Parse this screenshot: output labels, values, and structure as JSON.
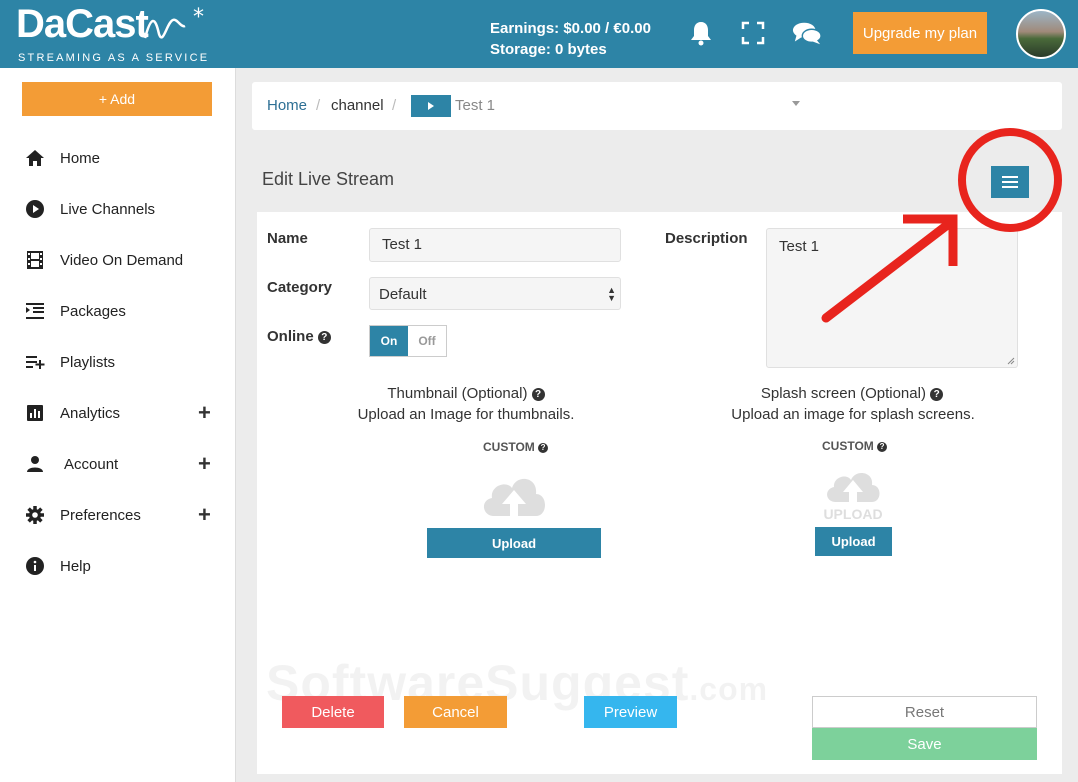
{
  "header": {
    "logo_text": "DaCast",
    "logo_tagline": "STREAMING AS A SERVICE",
    "earnings": "Earnings: $0.00 / €0.00",
    "storage": "Storage: 0 bytes",
    "upgrade_label": "Upgrade my plan"
  },
  "sidebar": {
    "add_label": "+ Add",
    "items": [
      {
        "label": "Home",
        "icon": "home-icon"
      },
      {
        "label": "Live Channels",
        "icon": "play-circle-icon"
      },
      {
        "label": "Video On Demand",
        "icon": "film-icon"
      },
      {
        "label": "Packages",
        "icon": "packages-icon"
      },
      {
        "label": "Playlists",
        "icon": "playlist-add-icon"
      },
      {
        "label": "Analytics",
        "icon": "bar-chart-icon"
      },
      {
        "label": "Account",
        "icon": "user-icon"
      },
      {
        "label": "Preferences",
        "icon": "gear-icon"
      },
      {
        "label": "Help",
        "icon": "info-icon"
      }
    ]
  },
  "breadcrumb": {
    "home": "Home",
    "channel": "channel",
    "current": "Test 1"
  },
  "page": {
    "title": "Edit Live Stream"
  },
  "form": {
    "name_label": "Name",
    "name_value": "Test 1",
    "category_label": "Category",
    "category_value": "Default",
    "online_label": "Online",
    "toggle_on": "On",
    "toggle_off": "Off",
    "description_label": "Description",
    "description_value": "Test 1",
    "thumbnail_title": "Thumbnail (Optional)",
    "thumbnail_desc": "Upload an Image for thumbnails.",
    "splash_title": "Splash screen (Optional)",
    "splash_desc": "Upload an image for splash screens.",
    "custom_label": "CUSTOM",
    "upload_label": "Upload",
    "upload_placeholder": "UPLOAD"
  },
  "actions": {
    "delete": "Delete",
    "cancel": "Cancel",
    "preview": "Preview",
    "reset": "Reset",
    "save": "Save"
  },
  "watermark": {
    "main": "SoftwareSuggest",
    "suffix": ".com"
  },
  "colors": {
    "brand_blue": "#2d84a6",
    "orange": "#f39c36",
    "delete_red": "#f05a5e",
    "preview_blue": "#35b6ee",
    "save_green": "#7dd19b",
    "annotation_red": "#e8241d"
  }
}
